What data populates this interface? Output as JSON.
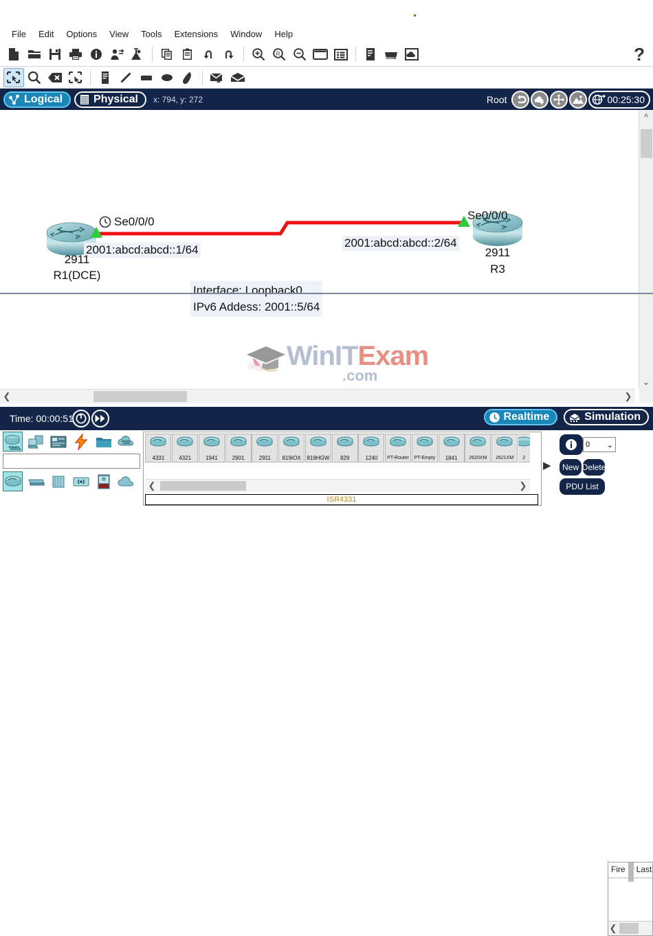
{
  "menu": {
    "items": [
      "File",
      "Edit",
      "Options",
      "View",
      "Tools",
      "Extensions",
      "Window",
      "Help"
    ]
  },
  "toolbar_main": {
    "icons": [
      "new-file-icon",
      "open-folder-icon",
      "save-icon",
      "print-icon",
      "info-icon",
      "activity-wizard-icon",
      "network-lab-icon",
      "copy-icon",
      "paste-icon",
      "undo-icon",
      "redo-icon",
      "zoom-in-icon",
      "zoom-reset-icon",
      "zoom-out-icon",
      "palette-window-icon",
      "custom-devices-icon",
      "view-pane-icon",
      "network-device-icon",
      "cloud-device-icon"
    ],
    "help_label": "?"
  },
  "toolbar_right": {
    "icons": [
      "select-icon",
      "inspect-icon",
      "delete-icon",
      "resize-shape-icon",
      "note-icon",
      "draw-line-icon",
      "draw-rectangle-icon",
      "draw-ellipse-icon",
      "draw-freeform-icon",
      "add-simple-pdu-icon",
      "add-complex-pdu-icon"
    ]
  },
  "viewbar": {
    "logical_label": "Logical",
    "physical_label": "Physical",
    "coords": "x: 794, y: 272",
    "root_label": "Root",
    "clock": "00:25:30",
    "icons": [
      "logical-view-icon",
      "physical-view-icon",
      "back-icon",
      "new-cluster-icon",
      "move-object-icon",
      "set-background-icon",
      "viewport-icon"
    ]
  },
  "topology": {
    "left_router": {
      "model": "2911",
      "name": "R1(DCE)",
      "interface": "Se0/0/0",
      "address": "2001:abcd:abcd::1/64"
    },
    "right_router": {
      "model": "2911",
      "name": "R3",
      "interface": "Se0/0/0",
      "address": "2001:abcd:abcd::2/64"
    },
    "note": {
      "line1": "Interface: Loopback0",
      "line2": "IPv6 Addess: 2001::5/64"
    },
    "link_color": "#ee1111"
  },
  "watermark": {
    "part1": "Win",
    "part2": "IT",
    "part3": "Exam",
    "part4": ".com"
  },
  "statusbar": {
    "time_label": "Time: 00:00:51",
    "realtime_label": "Realtime",
    "simulation_label": "Simulation",
    "icons": [
      "power-cycle-icon",
      "fast-forward-icon",
      "realtime-clock-icon",
      "simulation-icon"
    ]
  },
  "palette": {
    "categories_row1": [
      "network-devices-icon",
      "end-devices-icon",
      "components-icon",
      "connections-icon",
      "miscellaneous-icon",
      "multiuser-connection-icon"
    ],
    "categories_row2": [
      "routers-icon",
      "switches-icon",
      "hubs-icon",
      "wireless-devices-icon",
      "wan-emulation-icon",
      "cloud-icon"
    ],
    "search_value": "",
    "devices": [
      "4331",
      "4321",
      "1941",
      "2901",
      "2911",
      "819IOX",
      "819HGW",
      "829",
      "1240",
      "PT-Router",
      "PT-Empty",
      "1841",
      "2620XM",
      "2621XM",
      "2"
    ],
    "selected_device_label": "ISR4331"
  },
  "pdu_panel": {
    "scenario_value": "0",
    "new_label": "New",
    "delete_label": "Delete",
    "pdu_list_label": "PDU List ",
    "toggle_icon": "info-icon",
    "columns": [
      "Fire",
      "Last"
    ]
  }
}
